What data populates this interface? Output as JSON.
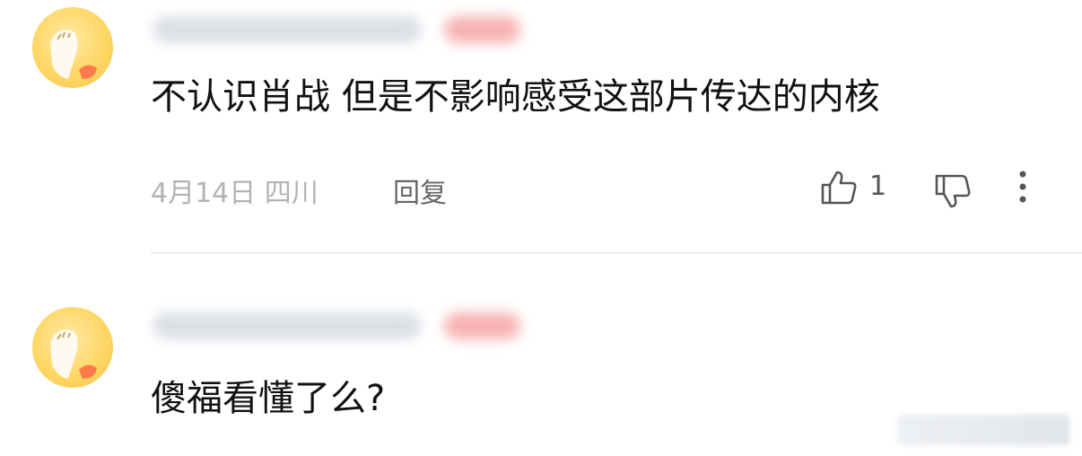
{
  "comments": [
    {
      "text": "不认识肖战 但是不影响感受这部片传达的内核",
      "date_location": "4月14日 四川",
      "reply_label": "回复",
      "like_count": "1"
    },
    {
      "text": "傻福看懂了么?"
    }
  ],
  "icons": {
    "like": "thumbs-up-icon",
    "dislike": "thumbs-down-icon",
    "more": "more-vertical-icon"
  },
  "colors": {
    "avatar": "#ffd766",
    "secondary_text": "#b3b3b3",
    "primary_text": "#111111"
  }
}
